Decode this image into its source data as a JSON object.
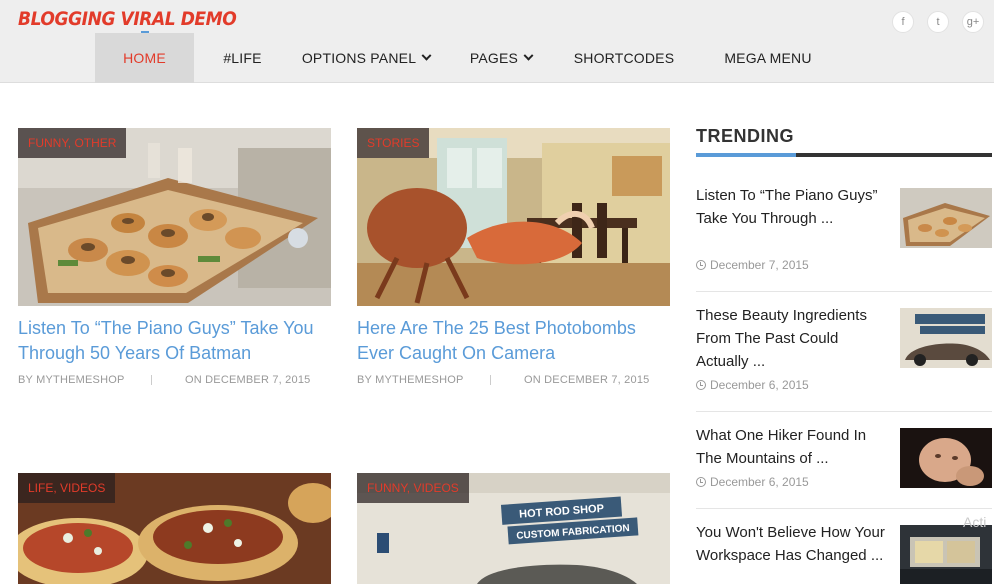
{
  "site": {
    "logo": "BLOGGING VIRAL DEMO"
  },
  "social": [
    {
      "label": "f",
      "icon": "facebook-icon"
    },
    {
      "label": "t",
      "icon": "twitter-icon"
    },
    {
      "label": "g+",
      "icon": "google-plus-icon"
    }
  ],
  "nav": {
    "items": [
      {
        "label": "HOME",
        "active": true,
        "dropdown": false
      },
      {
        "label": "#LIFE",
        "active": false,
        "dropdown": false
      },
      {
        "label": "OPTIONS PANEL",
        "active": false,
        "dropdown": true
      },
      {
        "label": "PAGES",
        "active": false,
        "dropdown": true
      },
      {
        "label": "SHORTCODES",
        "active": false,
        "dropdown": false
      },
      {
        "label": "MEGA MENU",
        "active": false,
        "dropdown": false
      }
    ]
  },
  "posts": [
    {
      "category": "FUNNY, OTHER",
      "title": "Listen To “The Piano Guys” Take You Through 50 Years Of Batman",
      "author": "BY MYTHEMESHOP",
      "date": "ON DECEMBER 7, 2015",
      "image": "bagel-box-image"
    },
    {
      "category": "STORIES",
      "title": "Here Are The 25 Best Photobombs Ever Caught On Camera",
      "author": "BY MYTHEMESHOP",
      "date": "ON DECEMBER 7, 2015",
      "image": "crab-in-dining-room-image"
    },
    {
      "category": "LIFE, VIDEOS",
      "image": "tacos-image"
    },
    {
      "category": "FUNNY, VIDEOS",
      "image": "hot-rod-shop-image",
      "sign_line1": "HOT ROD SHOP",
      "sign_line2": "CUSTOM FABRICATION"
    }
  ],
  "trending": {
    "heading": "TRENDING",
    "items": [
      {
        "title": "Listen To “The Piano Guys” Take You Through ...",
        "date": "December 7, 2015",
        "image": "bagel-box-thumb"
      },
      {
        "title": "These Beauty Ingredients From The Past Could Actually ...",
        "date": "December 6, 2015",
        "image": "hot-rod-thumb"
      },
      {
        "title": "What One Hiker Found In The Mountains of ...",
        "date": "December 6, 2015",
        "image": "baby-thumb"
      },
      {
        "title": "You Won't Believe How Your Workspace Has Changed ...",
        "date": "",
        "image": "workspace-thumb"
      }
    ]
  },
  "watermark": "Acti",
  "colors": {
    "accent_red": "#e23b2a",
    "link_blue": "#5a9bd8",
    "header_bg": "#eeeeee"
  }
}
